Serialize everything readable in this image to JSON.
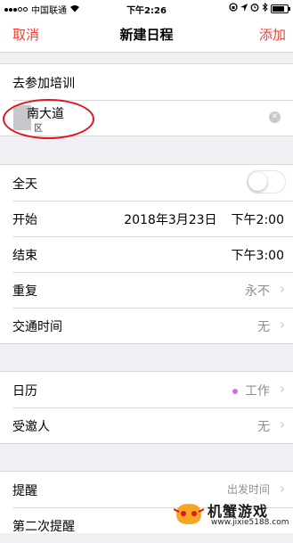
{
  "status_bar": {
    "carrier": "中国联通",
    "time": "下午2:26"
  },
  "nav": {
    "cancel": "取消",
    "title": "新建日程",
    "add": "添加"
  },
  "event": {
    "title": "去参加培训",
    "location_title": "南大道",
    "location_sub": "区"
  },
  "timing": {
    "all_day_label": "全天",
    "all_day_on": false,
    "start_label": "开始",
    "start_date": "2018年3月23日",
    "start_time": "下午2:00",
    "end_label": "结束",
    "end_time": "下午3:00",
    "repeat_label": "重复",
    "repeat_value": "永不",
    "travel_label": "交通时间",
    "travel_value": "无"
  },
  "calendar": {
    "calendar_label": "日历",
    "calendar_value": "工作",
    "calendar_color": "#cc73e1",
    "invitees_label": "受邀人",
    "invitees_value": "无"
  },
  "alerts": {
    "alert_label": "提醒",
    "alert_value": "出发时间",
    "second_alert_label": "第二次提醒"
  },
  "watermark": {
    "name": "机蟹游戏",
    "url": "www.jixie5188.com"
  }
}
